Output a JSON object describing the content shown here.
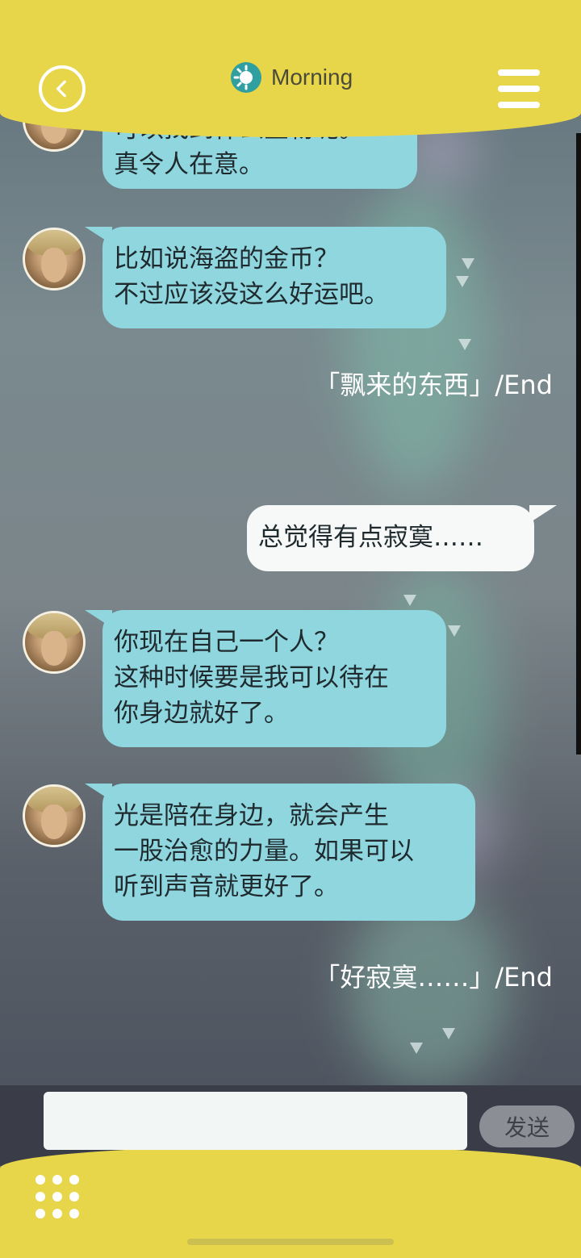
{
  "header": {
    "title": "Morning"
  },
  "messages": {
    "m0": {
      "text": "可以找到什么宝物呢。\n真令人在意。"
    },
    "m1": {
      "text": "比如说海盗的金币？\n不过应该没这么好运吧。"
    },
    "end1": "「飘来的东西」/End",
    "m2": {
      "text": "总觉得有点寂寞……"
    },
    "m3": {
      "text": "你现在自己一个人？\n这种时候要是我可以待在\n你身边就好了。"
    },
    "m4": {
      "text": "光是陪在身边，就会产生\n一股治愈的力量。如果可以\n听到声音就更好了。"
    },
    "end2": "「好寂寞……」/End"
  },
  "input": {
    "value": "",
    "placeholder": ""
  },
  "send_label": "发送",
  "colors": {
    "accent": "#e8d64a",
    "bubble_bot": "#8fd6df",
    "bubble_user": "#f7f9f8"
  }
}
